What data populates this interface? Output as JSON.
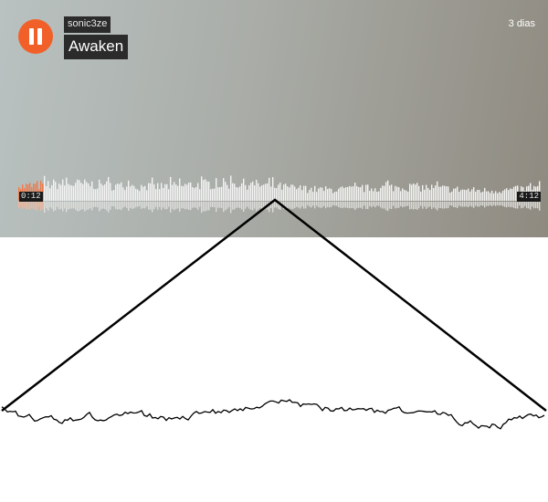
{
  "player": {
    "username": "sonic3ze",
    "title": "Awaken",
    "posted": "3 dias",
    "current_time": "0:12",
    "duration": "4:12",
    "progress_fraction": 0.048,
    "state": "playing",
    "play_state_icon": "pause-icon"
  },
  "colors": {
    "accent": "#f2602a",
    "played": "#f07a4a",
    "unplayed": "#f4f4f4",
    "label_bg": "#2b2b2b"
  }
}
